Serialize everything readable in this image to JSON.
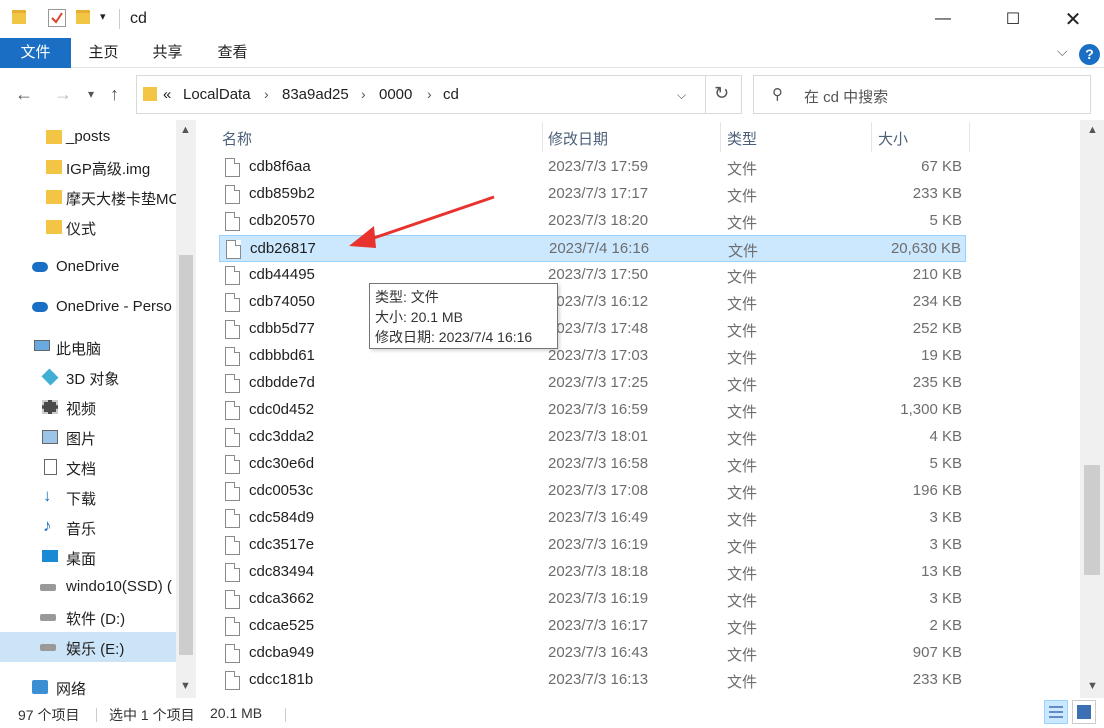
{
  "window": {
    "title": "cd",
    "minimize_icon": "minimize-icon",
    "maximize_icon": "maximize-icon",
    "close_icon": "close-icon"
  },
  "ribbon": {
    "tabs": [
      "文件",
      "主页",
      "共享",
      "查看"
    ],
    "accent": "#1a6fc4"
  },
  "address": {
    "overflow": "«",
    "segments": [
      "LocalData",
      "83a9ad25",
      "0000",
      "cd"
    ]
  },
  "search": {
    "placeholder": "在 cd 中搜索"
  },
  "nav": {
    "items": [
      {
        "label": "_posts",
        "icon": "folder-icon"
      },
      {
        "label": "IGP高级.img",
        "icon": "folder-icon"
      },
      {
        "label": "摩天大楼卡垫MC",
        "icon": "folder-icon"
      },
      {
        "label": "仪式",
        "icon": "folder-icon"
      },
      {
        "label": "OneDrive",
        "icon": "cloud-icon"
      },
      {
        "label": "OneDrive - Perso",
        "icon": "cloud-icon"
      },
      {
        "label": "此电脑",
        "icon": "computer-icon"
      },
      {
        "label": "3D 对象",
        "icon": "cube-icon"
      },
      {
        "label": "视频",
        "icon": "video-icon"
      },
      {
        "label": "图片",
        "icon": "picture-icon"
      },
      {
        "label": "文档",
        "icon": "document-icon"
      },
      {
        "label": "下载",
        "icon": "download-icon"
      },
      {
        "label": "音乐",
        "icon": "music-icon"
      },
      {
        "label": "桌面",
        "icon": "desktop-icon"
      },
      {
        "label": "windo10(SSD) (",
        "icon": "drive-icon"
      },
      {
        "label": "软件 (D:)",
        "icon": "drive-icon"
      },
      {
        "label": "娱乐 (E:)",
        "icon": "drive-icon"
      },
      {
        "label": "网络",
        "icon": "network-icon"
      }
    ]
  },
  "columns": [
    "名称",
    "修改日期",
    "类型",
    "大小"
  ],
  "files": [
    {
      "name": "cdb8f6aa",
      "date": "2023/7/3 17:59",
      "type": "文件",
      "size": "67 KB"
    },
    {
      "name": "cdb859b2",
      "date": "2023/7/3 17:17",
      "type": "文件",
      "size": "233 KB"
    },
    {
      "name": "cdb20570",
      "date": "2023/7/3 18:20",
      "type": "文件",
      "size": "5 KB"
    },
    {
      "name": "cdb26817",
      "date": "2023/7/4 16:16",
      "type": "文件",
      "size": "20,630 KB"
    },
    {
      "name": "cdb44495",
      "date": "2023/7/3 17:50",
      "type": "文件",
      "size": "210 KB"
    },
    {
      "name": "cdb74050",
      "date": "2023/7/3 16:12",
      "type": "文件",
      "size": "234 KB"
    },
    {
      "name": "cdbb5d77",
      "date": "2023/7/3 17:48",
      "type": "文件",
      "size": "252 KB"
    },
    {
      "name": "cdbbbd61",
      "date": "2023/7/3 17:03",
      "type": "文件",
      "size": "19 KB"
    },
    {
      "name": "cdbdde7d",
      "date": "2023/7/3 17:25",
      "type": "文件",
      "size": "235 KB"
    },
    {
      "name": "cdc0d452",
      "date": "2023/7/3 16:59",
      "type": "文件",
      "size": "1,300 KB"
    },
    {
      "name": "cdc3dda2",
      "date": "2023/7/3 18:01",
      "type": "文件",
      "size": "4 KB"
    },
    {
      "name": "cdc30e6d",
      "date": "2023/7/3 16:58",
      "type": "文件",
      "size": "5 KB"
    },
    {
      "name": "cdc0053c",
      "date": "2023/7/3 17:08",
      "type": "文件",
      "size": "196 KB"
    },
    {
      "name": "cdc584d9",
      "date": "2023/7/3 16:49",
      "type": "文件",
      "size": "3 KB"
    },
    {
      "name": "cdc3517e",
      "date": "2023/7/3 16:19",
      "type": "文件",
      "size": "3 KB"
    },
    {
      "name": "cdc83494",
      "date": "2023/7/3 18:18",
      "type": "文件",
      "size": "13 KB"
    },
    {
      "name": "cdca3662",
      "date": "2023/7/3 16:19",
      "type": "文件",
      "size": "3 KB"
    },
    {
      "name": "cdcae525",
      "date": "2023/7/3 16:17",
      "type": "文件",
      "size": "2 KB"
    },
    {
      "name": "cdcba949",
      "date": "2023/7/3 16:43",
      "type": "文件",
      "size": "907 KB"
    },
    {
      "name": "cdcc181b",
      "date": "2023/7/3 16:13",
      "type": "文件",
      "size": "233 KB"
    }
  ],
  "selected_file": "cdb26817",
  "tooltip": {
    "type_line": "类型: 文件",
    "size_line": "大小: 20.1 MB",
    "date_line": "修改日期: 2023/7/4 16:16"
  },
  "annotation": {
    "arrow_color": "#e8322e"
  },
  "status": {
    "count": "97 个项目",
    "selection": "选中 1 个项目",
    "selection_size": "20.1 MB"
  }
}
